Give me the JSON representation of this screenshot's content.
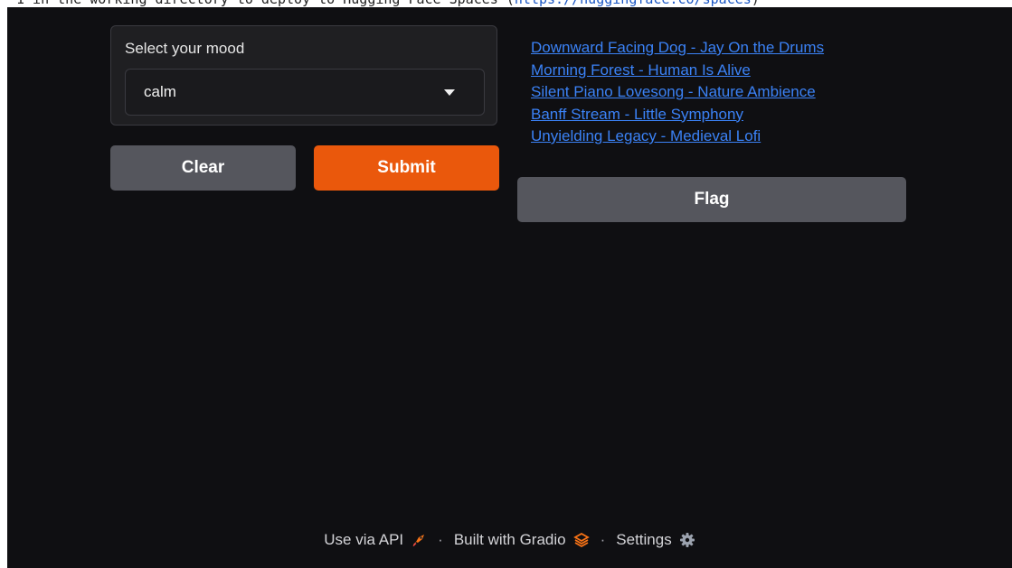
{
  "top_strip": {
    "text": "1 in the working directory to deploy to Hugging Face Spaces (",
    "link": "https://huggingface.co/spaces",
    "tail": ")"
  },
  "mood": {
    "label": "Select your mood",
    "selected": "calm"
  },
  "buttons": {
    "clear": "Clear",
    "submit": "Submit",
    "flag": "Flag"
  },
  "playlist": [
    "Downward Facing Dog - Jay On the Drums",
    "Morning Forest - Human Is Alive",
    "Silent Piano Lovesong - Nature Ambience",
    "Banff Stream - Little Symphony",
    "Unyielding Legacy - Medieval Lofi"
  ],
  "footer": {
    "api": "Use via API",
    "built": "Built with Gradio",
    "settings": "Settings",
    "separator": "·"
  },
  "colors": {
    "accent": "#ea580c",
    "link": "#3b82f6",
    "background": "#0f0f12"
  },
  "icons": {
    "api": "rocket-icon",
    "gradio": "gradio-logo-icon",
    "settings": "gear-icon",
    "select": "chevron-down-icon"
  }
}
